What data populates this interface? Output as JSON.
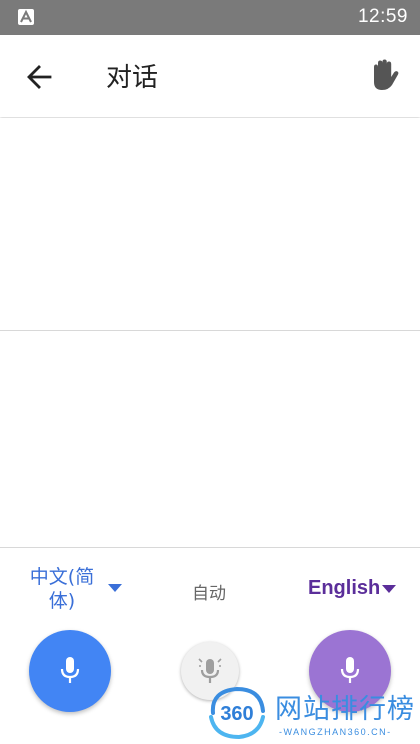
{
  "status_bar": {
    "time": "12:59",
    "app_icon": "a-app-icon"
  },
  "app_bar": {
    "back_icon": "arrow-back-icon",
    "title": "对话",
    "hand_icon": "hand-wave-icon"
  },
  "languages": {
    "source": "中文(简体)",
    "auto": "自动",
    "target": "English"
  },
  "mic_buttons": {
    "source_icon": "mic-icon",
    "auto_icon": "mic-auto-icon",
    "target_icon": "mic-icon"
  },
  "watermark": {
    "logo_text": "360",
    "title": "网站排行榜",
    "subtitle": "-WANGZHAN360.CN-"
  },
  "colors": {
    "source_accent": "#4285f4",
    "target_accent": "#9b74d3",
    "status_bar": "#7a7a7a"
  }
}
